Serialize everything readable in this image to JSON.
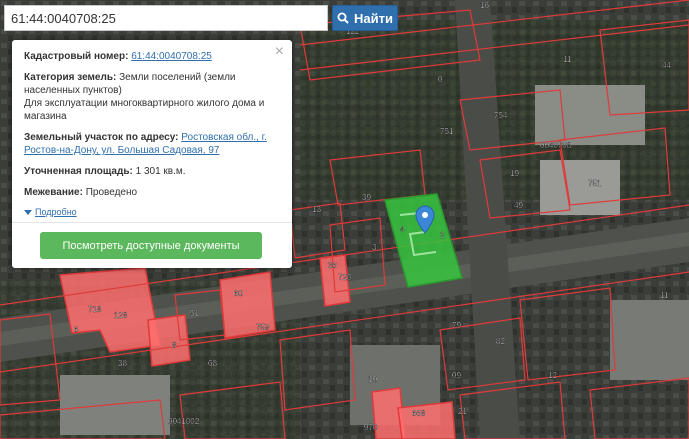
{
  "search": {
    "value": "61:44:0040708:25",
    "button_label": "Найти"
  },
  "popup": {
    "cadastral_label": "Кадастровый номер:",
    "cadastral_value": "61:44:0040708:25",
    "category_label": "Категория земель:",
    "category_value": "Земли поселений (земли населенных пунктов)",
    "usage": "Для эксплуатации многоквартирного жилого дома и магазина",
    "address_label": "Земельный участок по адресу:",
    "address_value": "Ростовская обл., г. Ростов-на-Дону, ул. Большая Садовая, 97",
    "area_label": "Уточненная площадь:",
    "area_value": "1 301 кв.м.",
    "survey_label": "Межевание:",
    "survey_value": "Проведено",
    "more_link": "Подробно",
    "docs_button": "Посмотреть доступные документы"
  },
  "map": {
    "parcel_labels": [
      "16",
      "122",
      "11",
      "44",
      "0",
      "754",
      "751",
      "0040708",
      "19",
      "49",
      "751",
      "39",
      "4",
      "3",
      "36",
      "720",
      "2",
      "13",
      "718",
      "128",
      "51",
      "60",
      "759",
      "68",
      "6",
      "8",
      "38",
      "79",
      "82",
      "10",
      "09",
      "12",
      "11",
      "0041002",
      "21",
      "970",
      "668"
    ],
    "colors": {
      "boundary": "#e03a3a",
      "selected_fill": "#37c43e",
      "highlight_fill": "#ff6e6e",
      "marker": "#3b86d6"
    }
  }
}
